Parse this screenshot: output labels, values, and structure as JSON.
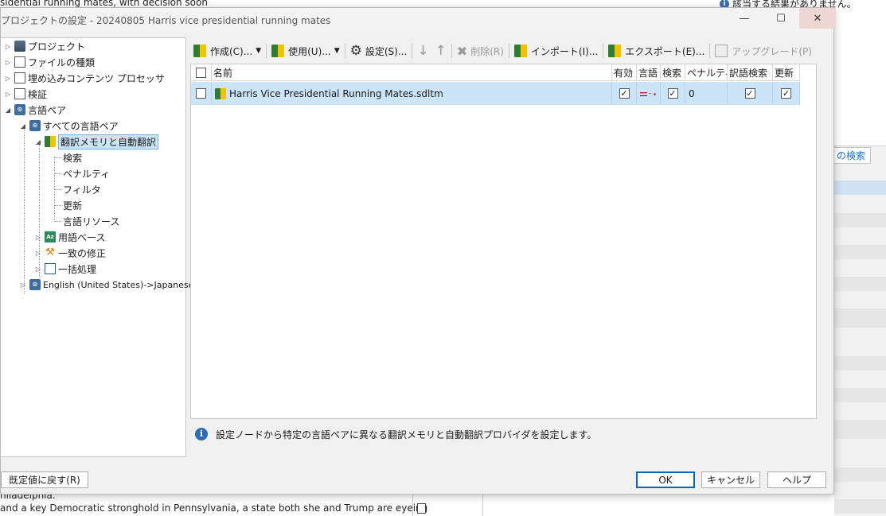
{
  "background": {
    "top_text": "sidential running mates, with decision soon",
    "right_info": "該当する結果がありません。",
    "right_search": "の検索",
    "bottom_text_1": "hiladelphia.",
    "bottom_text_2": "and a key Democratic stronghold in Pennsylvania, a state both she and Trump are eyeing"
  },
  "dialog": {
    "title": "プロジェクトの設定 - 20240805 Harris vice presidential running mates",
    "window_buttons": {
      "minimize": "—",
      "maximize": "☐",
      "close": "✕"
    },
    "tree": [
      {
        "label": "プロジェクト",
        "icon": "folder-icon"
      },
      {
        "label": "ファイルの種類",
        "icon": "file-types-icon"
      },
      {
        "label": "埋め込みコンテンツ プロセッサ",
        "icon": "processor-icon"
      },
      {
        "label": "検証",
        "icon": "verification-icon"
      },
      {
        "label": "言語ペア",
        "icon": "language-pair-icon"
      },
      {
        "label": "すべての言語ペア",
        "icon": "language-pair-icon"
      },
      {
        "label": "翻訳メモリと自動翻訳",
        "icon": "translation-memory-icon"
      },
      {
        "label": "検索"
      },
      {
        "label": "ペナルティ"
      },
      {
        "label": "フィルタ"
      },
      {
        "label": "更新"
      },
      {
        "label": "言語リソース"
      },
      {
        "label": "用語ベース",
        "icon": "termbase-icon"
      },
      {
        "label": "一致の修正",
        "icon": "wrench-icon"
      },
      {
        "label": "一括処理",
        "icon": "batch-icon"
      },
      {
        "label": "English (United States)->Japanese",
        "icon": "language-pair-icon"
      }
    ],
    "toolbar": {
      "create": "作成(C)...",
      "use": "使用(U)...",
      "settings": "設定(S)...",
      "delete": "削除(R)",
      "import": "インポート(I)...",
      "export": "エクスポート(E)...",
      "upgrade": "アップグレード(P)"
    },
    "grid": {
      "columns": [
        "名前",
        "有効",
        "言語",
        "検索",
        "ペナルティ",
        "訳語検索",
        "更新"
      ],
      "rows": [
        {
          "name": "Harris Vice Presidential Running Mates.sdltm",
          "enabled": true,
          "search": true,
          "penalty": "0",
          "concordance": true,
          "update": true
        }
      ]
    },
    "info_text": "設定ノードから特定の言語ペアに異なる翻訳メモリと自動翻訳プロバイダを設定します。",
    "buttons": {
      "reset": "既定値に戻す(R)",
      "ok": "OK",
      "cancel": "キャンセル",
      "help": "ヘルプ"
    }
  }
}
